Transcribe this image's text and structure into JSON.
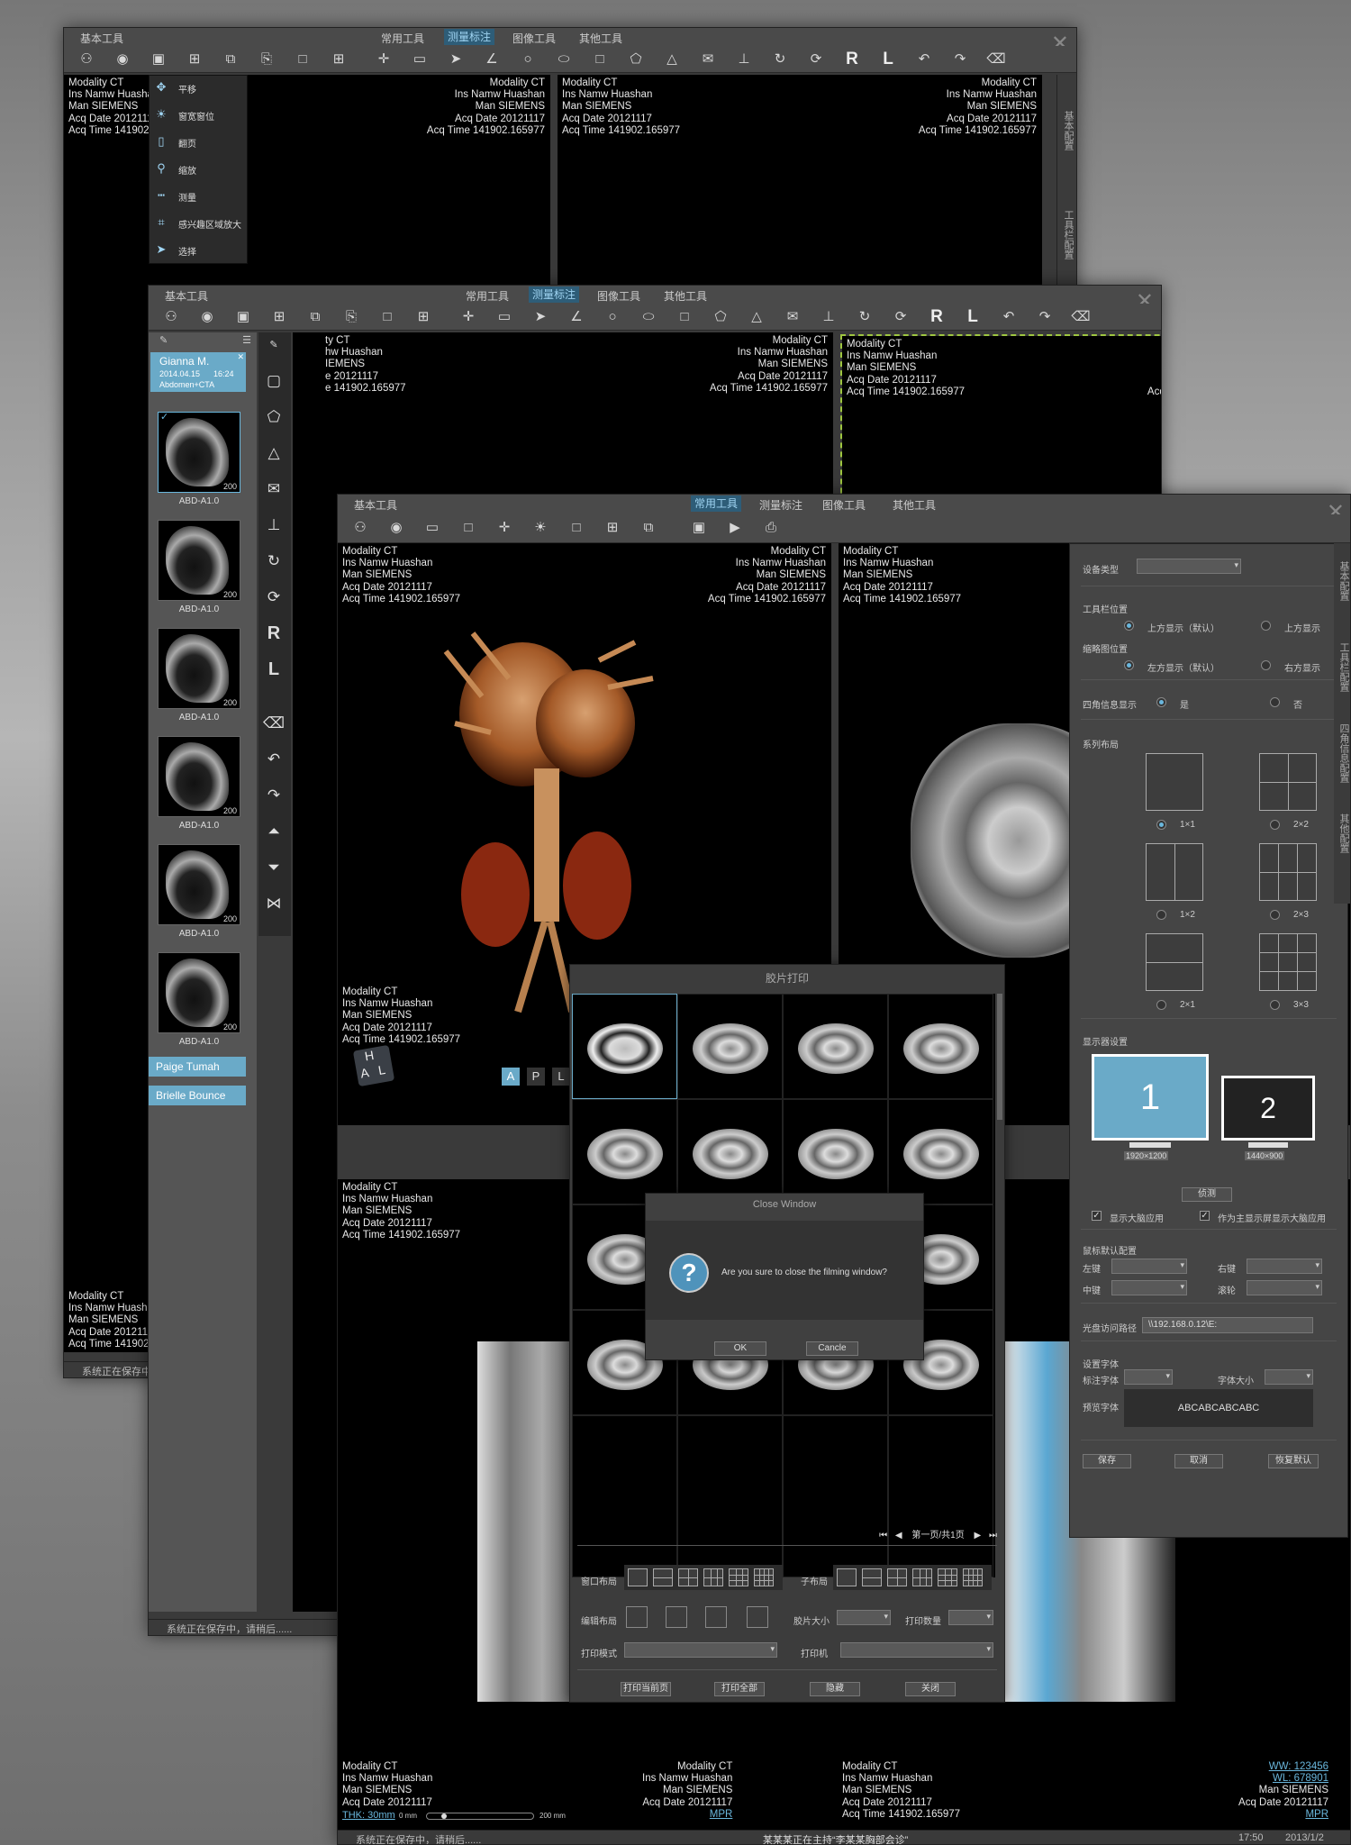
{
  "overlay": {
    "modality": "Modality CT",
    "institution": "Ins Namw Huashan",
    "manufacturer": "Man SIEMENS",
    "acq_date": "Acq Date 20121117",
    "acq_time": "Acq Time 141902.165977"
  },
  "overlay_clipped": {
    "institution": "Ins Namw Huasha",
    "acq_date": "Acq Date 2012111",
    "acq_time": "Acq Time 141902",
    "modality": "ty CT",
    "inst2": "hw Huashan",
    "man2": "IEMENS",
    "date2": "e 20121117",
    "time2": "e 141902.165977"
  },
  "tabs": {
    "basic": "基本工具",
    "common": "常用工具",
    "measure": "测量标注",
    "image": "图像工具",
    "other": "其他工具"
  },
  "side_tabs": {
    "basic_config": "基本配置",
    "toolbar_config": "工具栏配置",
    "corner_config": "四角信息配置",
    "other_config": "其他配置"
  },
  "status": {
    "saving": "系统正在保存中，请稍后......",
    "consult": "某某某正在主持“李某某胸部会诊”",
    "time": "17:50",
    "page": "2013/1/2"
  },
  "menu": [
    "平移",
    "窗宽窗位",
    "翻页",
    "缩放",
    "测量",
    "感兴趣区域放大",
    "选择"
  ],
  "patients": {
    "active_name": "Gianna M.",
    "active_date": "2014.04.15",
    "active_time": "16:24",
    "active_desc": "Abdomen+CTA",
    "p2": "Paige Tumah",
    "p3": "Brielle Bounce"
  },
  "thumbs": {
    "label": "ABD-A1.0",
    "count": "200"
  },
  "glyphs": {
    "R": "R",
    "L": "L",
    "cube_H": "H",
    "cube_A": "A",
    "cube_L": "L",
    "ori_A": "A",
    "ori_P": "P",
    "ori_L": "L"
  },
  "viewer": {
    "ww": "WW: 123456",
    "wl": "WL: 678901",
    "mpr": "MPR",
    "thk": "THK: 30mm",
    "slider_min": "0 mm",
    "slider_max": "200 mm"
  },
  "film": {
    "title": "胶片打印",
    "page_info": "第一页/共1页",
    "window_layout": "窗口布局",
    "sub_layout": "子布局",
    "edit_layout": "编辑布局",
    "film_size": "胶片大小",
    "print_count": "打印数量",
    "print_mode": "打印模式",
    "printer": "打印机",
    "print_current": "打印当前页",
    "print_all": "打印全部",
    "hide": "隐藏",
    "close": "关闭"
  },
  "dialog": {
    "title": "Close Window",
    "message": "Are you sure to close the filming window?",
    "ok": "OK",
    "cancel": "Cancle",
    "icon": "?"
  },
  "settings": {
    "device_type": "设备类型",
    "toolbar_pos": "工具栏位置",
    "top_default": "上方显示（默认）",
    "top": "上方显示",
    "thumb_pos": "缩略图位置",
    "left_default": "左方显示（默认）",
    "right": "右方显示",
    "corner_info": "四角信息显示",
    "yes": "是",
    "no": "否",
    "series_layout": "系列布局",
    "l11": "1×1",
    "l22": "2×2",
    "l12": "1×2",
    "l23": "2×3",
    "l21": "2×1",
    "l33": "3×3",
    "display_settings": "显示器设置",
    "mon1": "1",
    "mon2": "2",
    "res1": "1920×1200",
    "res2": "1440×900",
    "detect": "侦测",
    "show_large": "显示大脑应用",
    "main_large": "作为主显示屏显示大脑应用",
    "mouse_default": "鼠标默认配置",
    "left_key": "左键",
    "right_key": "右键",
    "middle_key": "中键",
    "wheel": "滚轮",
    "cd_path": "光盘访问路径",
    "cd_value": "\\\\192.168.0.12\\E:",
    "font_settings": "设置字体",
    "label_font": "标注字体",
    "font_size": "字体大小",
    "preview_font": "预览字体",
    "preview_text": "ABCABCABCABC",
    "save": "保存",
    "cancel": "取消",
    "restore": "恢复默认"
  }
}
